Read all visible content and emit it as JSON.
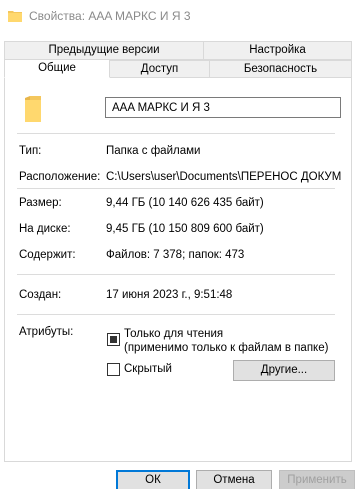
{
  "window": {
    "title": "Свойства: AAA МАРКС И Я 3"
  },
  "tabs": {
    "row1": [
      "Предыдущие версии",
      "Настройка"
    ],
    "row2": [
      "Общие",
      "Доступ",
      "Безопасность"
    ],
    "active": "Общие"
  },
  "general": {
    "name": "AAA МАРКС И Я 3",
    "type_label": "Тип:",
    "type_value": "Папка с файлами",
    "location_label": "Расположение:",
    "location_value": "C:\\Users\\user\\Documents\\ПЕРЕНОС ДОКУМЕ",
    "size_label": "Размер:",
    "size_value": "9,44 ГБ (10 140 626 435 байт)",
    "disk_label": "На диске:",
    "disk_value": "9,45 ГБ (10 150 809 600 байт)",
    "contains_label": "Содержит:",
    "contains_value": "Файлов: 7 378; папок: 473",
    "created_label": "Создан:",
    "created_value": "17 июня 2023 г., 9:51:48",
    "attributes_label": "Атрибуты:",
    "readonly_label_line1": "Только для чтения",
    "readonly_label_line2": "(применимо только к файлам в папке)",
    "readonly_state": "indeterminate",
    "hidden_label": "Скрытый",
    "hidden_checked": false,
    "other_button": "Другие..."
  },
  "footer": {
    "ok": "ОК",
    "cancel": "Отмена",
    "apply": "Применить"
  },
  "colors": {
    "folder": "#f4c75d",
    "accent": "#0078d7"
  }
}
